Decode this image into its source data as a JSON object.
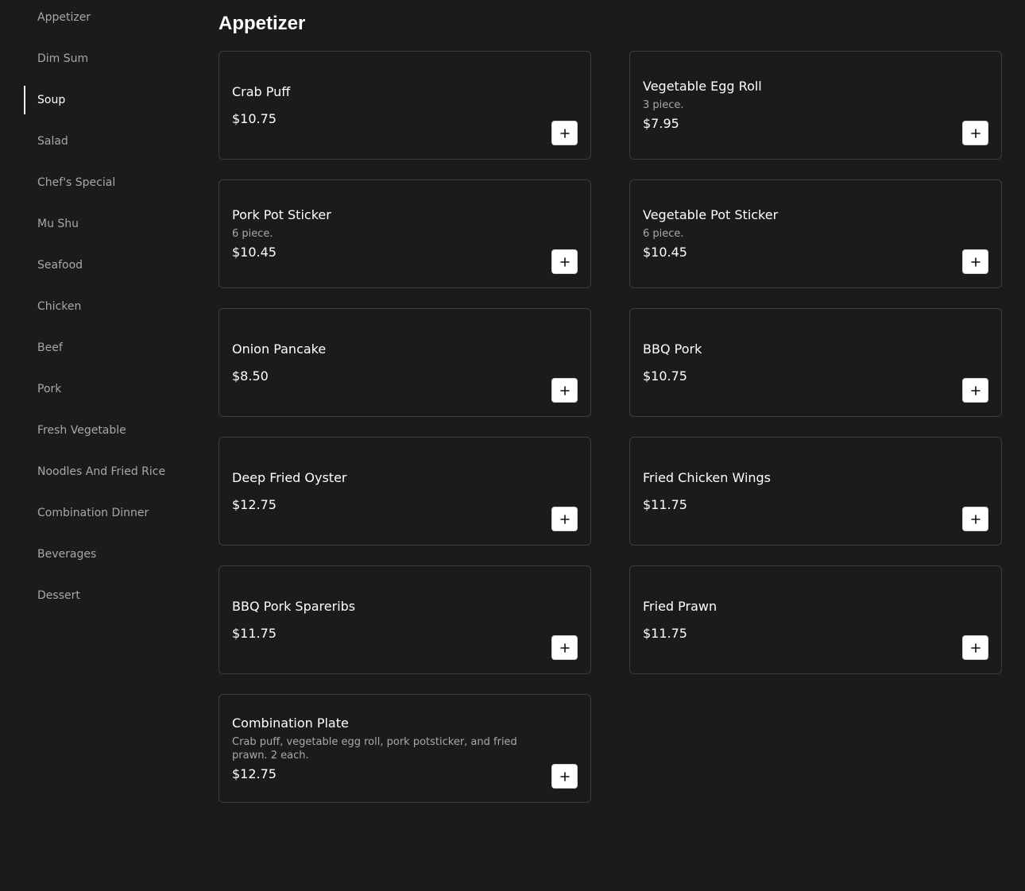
{
  "sidebar": {
    "items": [
      {
        "label": "Appetizer",
        "active": false
      },
      {
        "label": "Dim Sum",
        "active": false
      },
      {
        "label": "Soup",
        "active": true
      },
      {
        "label": "Salad",
        "active": false
      },
      {
        "label": "Chef's Special",
        "active": false
      },
      {
        "label": "Mu Shu",
        "active": false
      },
      {
        "label": "Seafood",
        "active": false
      },
      {
        "label": "Chicken",
        "active": false
      },
      {
        "label": "Beef",
        "active": false
      },
      {
        "label": "Pork",
        "active": false
      },
      {
        "label": "Fresh Vegetable",
        "active": false
      },
      {
        "label": "Noodles And Fried Rice",
        "active": false
      },
      {
        "label": "Combination Dinner",
        "active": false
      },
      {
        "label": "Beverages",
        "active": false
      },
      {
        "label": "Dessert",
        "active": false
      }
    ]
  },
  "section": {
    "title": "Appetizer"
  },
  "menu_items": [
    {
      "name": "Crab Puff",
      "description": "",
      "price": "$10.75",
      "add_icon": "plus-icon"
    },
    {
      "name": "Vegetable Egg Roll",
      "description": "3 piece.",
      "price": "$7.95",
      "add_icon": "plus-icon"
    },
    {
      "name": "Pork Pot Sticker",
      "description": "6 piece.",
      "price": "$10.45",
      "add_icon": "plus-icon"
    },
    {
      "name": "Vegetable Pot Sticker",
      "description": "6 piece.",
      "price": "$10.45",
      "add_icon": "plus-icon"
    },
    {
      "name": "Onion Pancake",
      "description": "",
      "price": "$8.50",
      "add_icon": "plus-icon"
    },
    {
      "name": "BBQ Pork",
      "description": "",
      "price": "$10.75",
      "add_icon": "plus-icon"
    },
    {
      "name": "Deep Fried Oyster",
      "description": "",
      "price": "$12.75",
      "add_icon": "plus-icon"
    },
    {
      "name": "Fried Chicken Wings",
      "description": "",
      "price": "$11.75",
      "add_icon": "plus-icon"
    },
    {
      "name": "BBQ Pork Spareribs",
      "description": "",
      "price": "$11.75",
      "add_icon": "plus-icon"
    },
    {
      "name": "Fried Prawn",
      "description": "",
      "price": "$11.75",
      "add_icon": "plus-icon"
    },
    {
      "name": "Combination Plate",
      "description": "Crab puff, vegetable egg roll, pork potsticker, and fried prawn. 2 each.",
      "price": "$12.75",
      "add_icon": "plus-icon"
    }
  ],
  "colors": {
    "background": "#1b1b1b",
    "card_border": "#3c3c3c",
    "text_primary": "#ffffff",
    "text_secondary": "#a8a8a8",
    "button_bg": "#ffffff"
  }
}
